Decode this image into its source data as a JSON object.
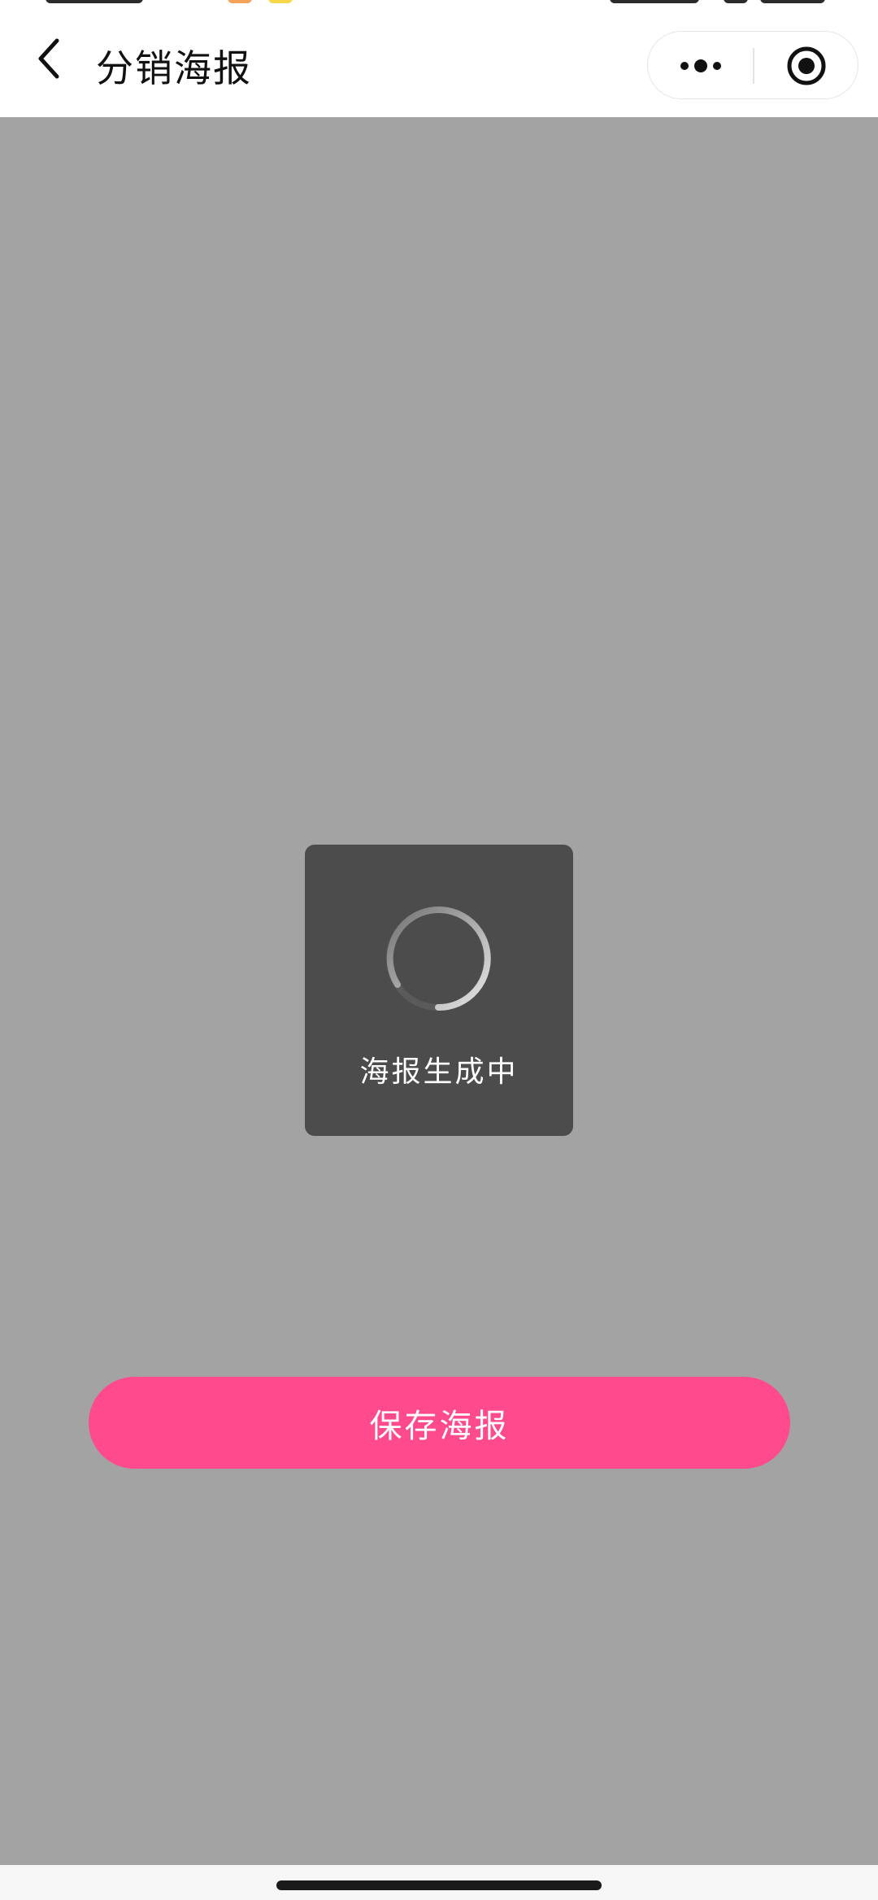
{
  "nav": {
    "title": "分销海报",
    "back_icon": "chevron-left-icon",
    "menu_icon": "more-dots-icon",
    "close_icon": "target-circle-icon"
  },
  "toast": {
    "text": "海报生成中",
    "icon": "spinner-icon"
  },
  "actions": {
    "save_label": "保存海报"
  },
  "colors": {
    "page_background": "#a3a3a3",
    "toast_background": "#4c4c4c",
    "accent": "#ff4a8d",
    "nav_background": "#ffffff"
  }
}
